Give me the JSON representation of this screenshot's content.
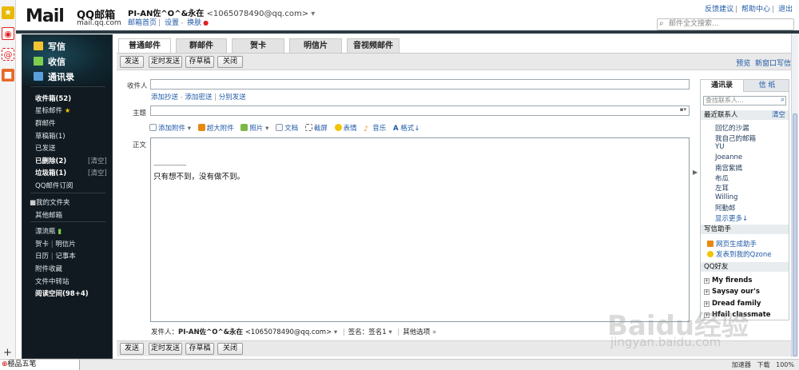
{
  "header": {
    "logo_text_main": "Mail",
    "logo_text_sub": "QQ邮箱",
    "logo_domain": "mail.qq.com",
    "account_name": "PI-AN佐^O^&永在",
    "account_email": "<1065078490@qq.com>",
    "links": [
      "邮箱首页",
      "设置",
      "换肤"
    ],
    "top_right_links": [
      "反馈建议",
      "帮助中心",
      "退出"
    ],
    "search_placeholder": "邮件全文搜索..."
  },
  "sidebar": {
    "write": "写信",
    "inbox_btn": "收信",
    "contacts_btn": "通讯录",
    "folders": {
      "inbox": "收件箱(52)",
      "starred": "星标邮件",
      "group": "群邮件",
      "drafts": "草稿箱(1)",
      "sent": "已发送",
      "deleted": "已删除(2)",
      "spam": "垃圾箱(1)",
      "subscriptions": "QQ邮件订阅",
      "clear1": "[清空]",
      "clear2": "[清空]",
      "my_folders": "我的文件夹",
      "other_mailbox": "其他邮箱",
      "drift_bottle": "漂流瓶",
      "cards": "贺卡",
      "postcards": "明信片",
      "calendar": "日历",
      "notes": "记事本",
      "attachments": "附件收藏",
      "file_transfer": "文件中转站",
      "reading_space": "阅读空间(98+4)"
    }
  },
  "compose": {
    "tabs": [
      "普通邮件",
      "群邮件",
      "贺卡",
      "明信片",
      "音视频邮件"
    ],
    "buttons": {
      "send": "发送",
      "timed_send": "定时发送",
      "save_draft": "存草稿",
      "close": "关闭"
    },
    "toolbar_right": [
      "预览",
      "新窗口写信"
    ],
    "to_label": "收件人",
    "cc_links": [
      "添加抄送",
      "添加密送",
      "分别发送"
    ],
    "subject_label": "主题",
    "body_label": "正文",
    "format_items": [
      "添加附件",
      "超大附件",
      "照片",
      "文档",
      "截屏",
      "表情",
      "音乐",
      "格式"
    ],
    "signature_dash": "------------------",
    "body_text": "只有想不到，没有做不到。",
    "footer_sender_label": "发件人：",
    "footer_sender_name": "PI-AN佐^O^&永在",
    "footer_sender_email": "<1065078490@qq.com>",
    "footer_signature": "签名：签名1",
    "footer_options": "其他选项"
  },
  "right_panel": {
    "tabs": [
      "通讯录",
      "信 纸"
    ],
    "search_placeholder": "查找联系人...",
    "recent_header": "最近联系人",
    "recent_clear": "清空",
    "recent_contacts": [
      "回忆的沙漏",
      "我自己的邮箱",
      "YU",
      "Joeanne",
      "南宫紫嫣",
      "布瓜",
      "左耳",
      "Willing",
      "阿勤郎"
    ],
    "show_more": "显示更多↓",
    "helper_header": "写信助手",
    "helper_items": [
      "网页生成助手",
      "发表到我的Qzone"
    ],
    "friends_header": "QQ好友",
    "friend_groups": [
      "My firends",
      "Saysay our's",
      "Dread family",
      "Hfail classmate"
    ]
  },
  "statusbar": {
    "ime": "極品五笔",
    "right_items": [
      "加速器",
      "下载",
      "100%"
    ]
  },
  "watermark": {
    "main": "Baidu经验",
    "sub": "jingyan.baidu.com"
  },
  "colors": {
    "sidebar_bg": "#101a20",
    "link_blue": "#1f5aa6",
    "logo_orange": "#e8890c"
  }
}
